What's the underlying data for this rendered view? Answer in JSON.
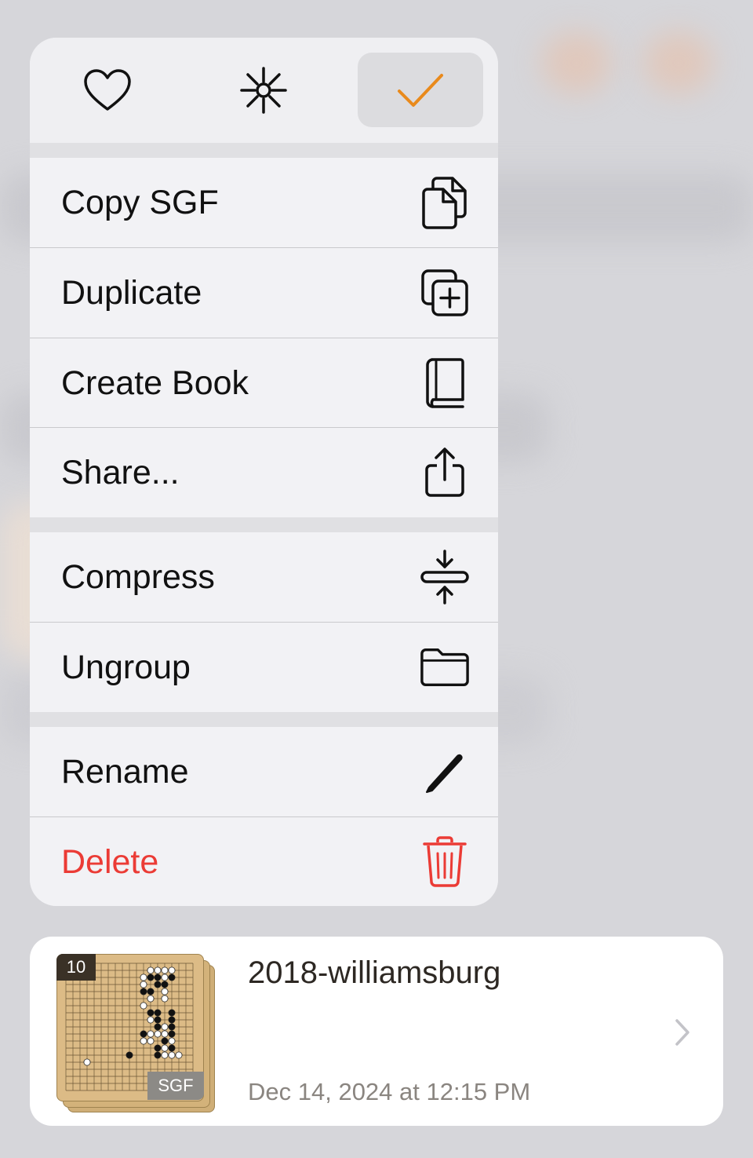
{
  "top_actions": [
    {
      "name": "favorite",
      "icon": "heart-icon",
      "selected": false
    },
    {
      "name": "highlight",
      "icon": "sparkle-icon",
      "selected": false
    },
    {
      "name": "select",
      "icon": "checkmark-icon",
      "selected": true
    }
  ],
  "accent_color": "#e98a1c",
  "destructive_color": "#eb3b35",
  "menu": {
    "copy_sgf": {
      "label": "Copy SGF",
      "icon": "copy-documents-icon"
    },
    "duplicate": {
      "label": "Duplicate",
      "icon": "duplicate-plus-icon"
    },
    "create_book": {
      "label": "Create Book",
      "icon": "book-icon"
    },
    "share": {
      "label": "Share...",
      "icon": "share-icon"
    },
    "compress": {
      "label": "Compress",
      "icon": "compress-arrows-icon"
    },
    "ungroup": {
      "label": "Ungroup",
      "icon": "folder-icon"
    },
    "rename": {
      "label": "Rename",
      "icon": "pencil-icon"
    },
    "delete": {
      "label": "Delete",
      "icon": "trash-icon"
    }
  },
  "file_card": {
    "move_count": "10",
    "format_badge": "SGF",
    "title": "2018-williamsburg",
    "date": "Dec 14, 2024 at 12:15 PM"
  }
}
